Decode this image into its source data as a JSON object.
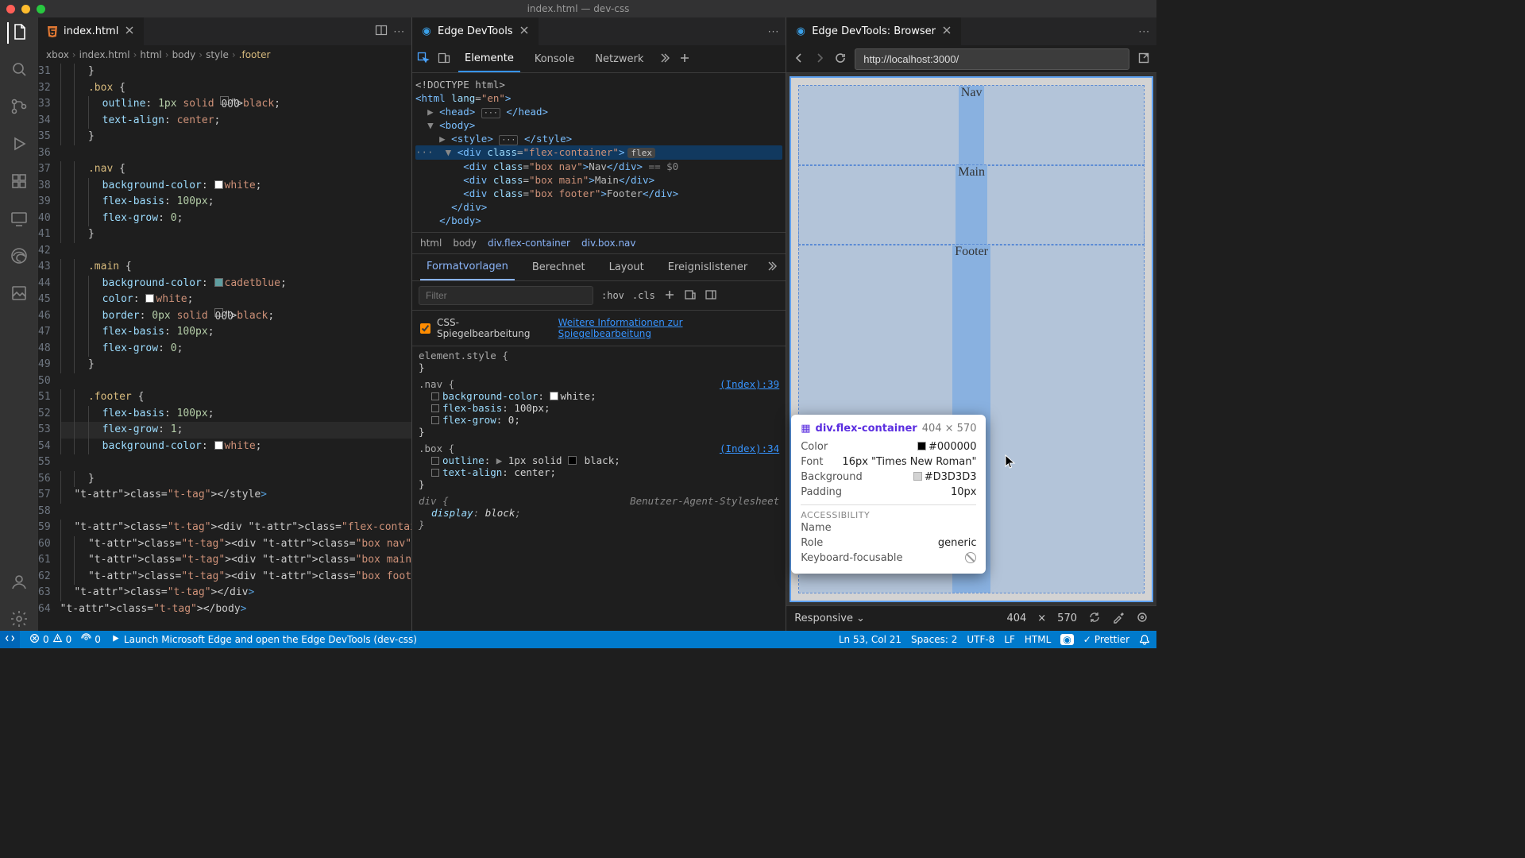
{
  "window": {
    "title": "index.html — dev-css"
  },
  "editor": {
    "tab": {
      "label": "index.html"
    },
    "breadcrumbs": [
      "xbox",
      "index.html",
      "html",
      "body",
      "style",
      ".footer"
    ],
    "first_line_no": 31,
    "cursor": "Ln 53, Col 21",
    "code_lines": {
      "31": "    }",
      "32": "    .box {",
      "33": "      outline: 1px solid ■black;",
      "34": "      text-align: center;",
      "35": "    }",
      "36": "",
      "37": "    .nav {",
      "38": "      background-color: ■white;",
      "39": "      flex-basis: 100px;",
      "40": "      flex-grow: 0;",
      "41": "    }",
      "42": "",
      "43": "    .main {",
      "44": "      background-color: ■cadetblue;",
      "45": "      color: ■white;",
      "46": "      border: 0px solid ■black;",
      "47": "      flex-basis: 100px;",
      "48": "      flex-grow: 0;",
      "49": "    }",
      "50": "",
      "51": "    .footer {",
      "52": "      flex-basis: 100px;",
      "53": "      flex-grow: 1;",
      "54": "      background-color: ■white;",
      "55": "",
      "56": "    }",
      "57": "  </style>",
      "58": "",
      "59": "  <div class=\"flex-container\">",
      "60": "    <div class=\"box nav\" >Nav</div>",
      "61": "    <div class=\"box main\">Main</div>",
      "62": "    <div class=\"box footer\">Footer</div>",
      "63": "  </div>",
      "64": "</body>"
    }
  },
  "devtools": {
    "tab": {
      "label": "Edge DevTools"
    },
    "top_tabs": {
      "elements": "Elemente",
      "console": "Konsole",
      "network": "Netzwerk"
    },
    "dom": {
      "doctype": "<!DOCTYPE html>",
      "html_open": "<html lang=\"en\">",
      "head": "<head> ··· </head>",
      "body_open": "<body>",
      "style": "<style> ··· </style>",
      "sel_open": "<div class=\"flex-container\">",
      "nav": "<div class=\"box nav\">Nav</div>",
      "nav_hint": " == $0",
      "main": "<div class=\"box main\">Main</div>",
      "footer": "<div class=\"box footer\">Footer</div>",
      "div_close": "</div>",
      "body_close": "</body>",
      "flex_badge": "flex"
    },
    "crumbs": {
      "a": "html",
      "b": "body",
      "c": "div.flex-container",
      "d": "div.box.nav"
    },
    "subtabs": {
      "styles": "Formatvorlagen",
      "computed": "Berechnet",
      "layout": "Layout",
      "listeners": "Ereignislistener"
    },
    "filter": {
      "placeholder": "Filter",
      "hov": ":hov",
      "cls": ".cls"
    },
    "mirror": {
      "label": "CSS-Spiegelbearbeitung",
      "link": "Weitere Informationen zur Spiegelbearbeitung"
    },
    "rules": {
      "elstyle": {
        "head": "element.style {",
        "close": "}"
      },
      "nav": {
        "sel": ".nav {",
        "close": "}",
        "src": "(Index):39",
        "p1k": "background-color",
        "p1v": "white",
        "p2k": "flex-basis",
        "p2v": "100px",
        "p3k": "flex-grow",
        "p3v": "0"
      },
      "box": {
        "sel": ".box {",
        "close": "}",
        "src": "(Index):34",
        "p1k": "outline",
        "p1v": "1px solid   black",
        "p2k": "text-align",
        "p2v": "center"
      },
      "div": {
        "sel": "div {",
        "close": "}",
        "src": "Benutzer-Agent-Stylesheet",
        "p1k": "display",
        "p1v": "block"
      }
    }
  },
  "browser": {
    "tab": {
      "label": "Edge DevTools: Browser"
    },
    "url": "http://localhost:3000/",
    "page": {
      "nav": "Nav",
      "main": "Main",
      "footer": "Footer"
    },
    "tooltip": {
      "name": "div.flex-container",
      "size": "404 × 570",
      "rows": {
        "color": {
          "label": "Color",
          "val": "#000000",
          "sw": "#000000"
        },
        "font": {
          "label": "Font",
          "val": "16px \"Times New Roman\""
        },
        "bg": {
          "label": "Background",
          "val": "#D3D3D3",
          "sw": "#D3D3D3"
        },
        "padding": {
          "label": "Padding",
          "val": "10px"
        }
      },
      "a11y_h": "ACCESSIBILITY",
      "a11y": {
        "name": {
          "label": "Name",
          "val": ""
        },
        "role": {
          "label": "Role",
          "val": "generic"
        },
        "focus": {
          "label": "Keyboard-focusable"
        }
      }
    },
    "bottom": {
      "device": "Responsive",
      "w": "404",
      "h": "570",
      "sep": "×"
    }
  },
  "status": {
    "remote": "",
    "errors": "0",
    "warnings": "0",
    "port": "0",
    "launch": "Launch Microsoft Edge and open the Edge DevTools (dev-css)",
    "spaces": "Spaces: 2",
    "enc": "UTF-8",
    "eol": "LF",
    "lang": "HTML",
    "prettier": "Prettier"
  }
}
